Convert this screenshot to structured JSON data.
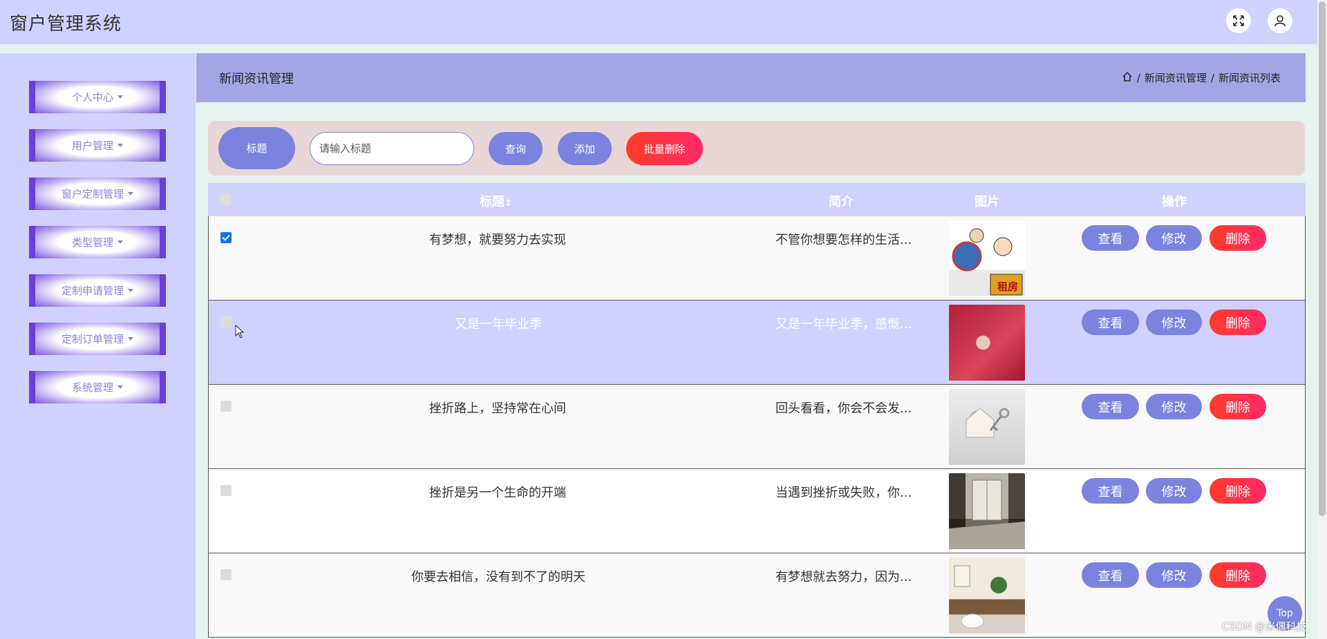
{
  "app": {
    "title": "窗户管理系统"
  },
  "header": {
    "icons": [
      "fullscreen-icon",
      "user-icon"
    ]
  },
  "sidebar": {
    "items": [
      {
        "label": "个人中心"
      },
      {
        "label": "用户管理"
      },
      {
        "label": "窗户定制管理"
      },
      {
        "label": "类型管理"
      },
      {
        "label": "定制申请管理"
      },
      {
        "label": "定制订单管理"
      },
      {
        "label": "系统管理"
      }
    ]
  },
  "page": {
    "title": "新闻资讯管理",
    "breadcrumb": {
      "level1": "新闻资讯管理",
      "level2": "新闻资讯列表",
      "separator": "/"
    }
  },
  "search": {
    "label": "标题",
    "placeholder": "请输入标题",
    "query_label": "查询",
    "add_label": "添加",
    "batch_delete_label": "批量删除"
  },
  "table": {
    "columns": {
      "title": "标题",
      "sort_glyph": "⇕",
      "summary": "简介",
      "image": "图片",
      "actions": "操作"
    },
    "action_labels": {
      "view": "查看",
      "edit": "修改",
      "delete": "删除"
    },
    "rows": [
      {
        "title": "有梦想，就要努力去实现",
        "summary": "不管你想要怎样的生活...",
        "checked": true
      },
      {
        "title": "又是一年毕业季",
        "summary": "又是一年毕业季，感慨...",
        "checked": false
      },
      {
        "title": "挫折路上，坚持常在心间",
        "summary": "回头看看，你会不会发...",
        "checked": false
      },
      {
        "title": "挫折是另一个生命的开端",
        "summary": "当遇到挫折或失败，你...",
        "checked": false
      },
      {
        "title": "你要去相信，没有到不了的明天",
        "summary": "有梦想就去努力，因为...",
        "checked": false
      }
    ],
    "image_texts": {
      "rent": "租房"
    }
  },
  "misc": {
    "top_button": "Top",
    "watermark": "CSDN @米偶科技"
  },
  "colors": {
    "accent": "#7b83de",
    "danger": "#ff2a4a",
    "header_bg": "#d1d1ff",
    "pagebar_bg": "#a5a5e5",
    "searchbar_bg": "#e8d6d6",
    "row_highlight": "#d1d1ff"
  }
}
